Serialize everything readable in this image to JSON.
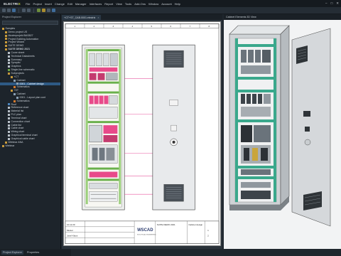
{
  "app": {
    "logo_main": "ELECTRI",
    "logo_accent": "X"
  },
  "menu": [
    "File",
    "Project",
    "Insert",
    "Change",
    "Edit",
    "Manager",
    "Interfaces",
    "Report",
    "View",
    "Tools",
    "Add-Ons",
    "Window",
    "Account",
    "Help"
  ],
  "window_controls": [
    "–",
    "□",
    "✕"
  ],
  "explorer": {
    "title": "Project Explorer",
    "tree": [
      {
        "label": "Samples",
        "indent": 0,
        "icon": "folder"
      },
      {
        "label": "Demo project US",
        "indent": 1,
        "icon": "folder"
      },
      {
        "label": "Musterprojekt BAS827",
        "indent": 1,
        "icon": "folder"
      },
      {
        "label": "Project Building Automation",
        "indent": 1,
        "icon": "folder"
      },
      {
        "label": "Project Wizard",
        "indent": 1,
        "icon": "folder"
      },
      {
        "label": "SUITE DEMO",
        "indent": 1,
        "icon": "folder"
      },
      {
        "label": "SUITE DEMO 2021",
        "indent": 1,
        "icon": "folder",
        "bold": true
      },
      {
        "label": "Cover sheet",
        "indent": 2,
        "icon": "page"
      },
      {
        "label": "Technical Datasheets",
        "indent": 2,
        "icon": "page"
      },
      {
        "label": "Summary",
        "indent": 2,
        "icon": "page"
      },
      {
        "label": "Synoptic",
        "indent": 2,
        "icon": "page"
      },
      {
        "label": "Graphics",
        "indent": 2,
        "icon": "page"
      },
      {
        "label": "Single-line schematic",
        "indent": 2,
        "icon": "green"
      },
      {
        "label": "Subprojects",
        "indent": 2,
        "icon": "folder"
      },
      {
        "label": "+CT",
        "indent": 3,
        "icon": "folder"
      },
      {
        "label": "Cabinet",
        "indent": 4,
        "icon": "cab"
      },
      {
        "label": "0001 - Cabinet design",
        "indent": 5,
        "icon": "cab",
        "selected": true
      },
      {
        "label": "Schematics",
        "indent": 4,
        "icon": "orange"
      },
      {
        "label": "+ST",
        "indent": 3,
        "icon": "folder"
      },
      {
        "label": "Cabinet",
        "indent": 4,
        "icon": "cab"
      },
      {
        "label": "0001 - Layout plan cont",
        "indent": 5,
        "icon": "cab"
      },
      {
        "label": "Schematics",
        "indent": 4,
        "icon": "orange"
      },
      {
        "label": "Roof",
        "indent": 2,
        "icon": "blue"
      },
      {
        "label": "Reference chart",
        "indent": 2,
        "icon": "page"
      },
      {
        "label": "Material list",
        "indent": 2,
        "icon": "page"
      },
      {
        "label": "PLC plan",
        "indent": 2,
        "icon": "page"
      },
      {
        "label": "Terminal chart",
        "indent": 2,
        "icon": "page"
      },
      {
        "label": "Connection chart",
        "indent": 2,
        "icon": "page"
      },
      {
        "label": "Cable list",
        "indent": 2,
        "icon": "page"
      },
      {
        "label": "Cable chart",
        "indent": 2,
        "icon": "page"
      },
      {
        "label": "Wiring chart",
        "indent": 2,
        "icon": "page"
      },
      {
        "label": "Graphical terminal chart",
        "indent": 2,
        "icon": "page"
      },
      {
        "label": "Graphical cable chart",
        "indent": 2,
        "icon": "page"
      },
      {
        "label": "Webinar ANA",
        "indent": 1,
        "icon": "folder"
      },
      {
        "label": "Webinar",
        "indent": 0,
        "icon": "folder"
      }
    ]
  },
  "bottom_tabs": [
    "Project Explorer",
    "Properties"
  ],
  "doc_tab": {
    "label": "+CT+ST_CAB.0001.electrix"
  },
  "view3d_title": "Cabinet Elements 3D View",
  "sheet": {
    "column_numbers": [
      "1",
      "2",
      "3",
      "4",
      "5",
      "6",
      "7",
      "8"
    ],
    "title_block": {
      "company": "WSCAD",
      "tagline": "ELECTRICAL ENGINEERING",
      "project": "SUITE DEMO 2021",
      "drawing_title": "Cabinet design",
      "date": "10.12.20",
      "creator": "Muster",
      "check": "Josef Klaus",
      "sheet_no": "1",
      "sheet_count": "2"
    }
  }
}
